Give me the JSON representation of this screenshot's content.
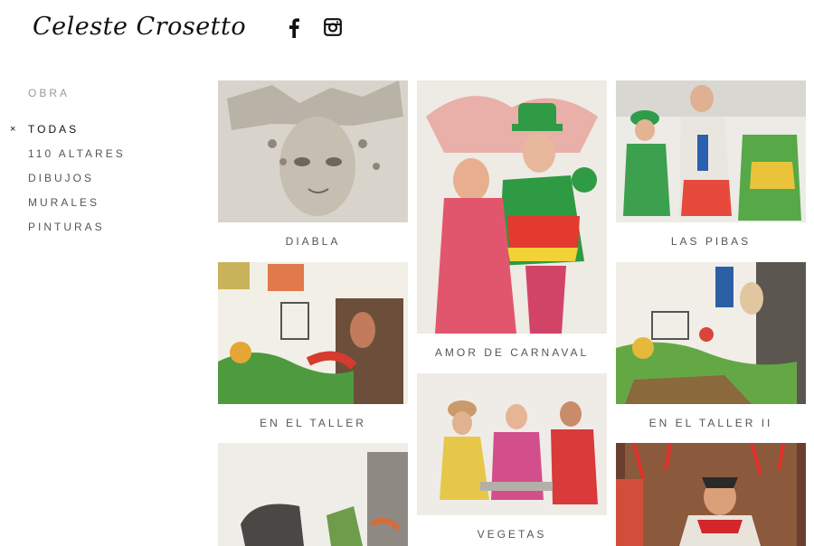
{
  "header": {
    "logo_text": "Celeste Crosetto",
    "social": [
      {
        "icon": "facebook-icon",
        "label": "f"
      },
      {
        "icon": "instagram-icon"
      }
    ]
  },
  "sidebar": {
    "heading": "OBRA",
    "active_marker": "×",
    "items": [
      {
        "label": "TODAS",
        "active": true
      },
      {
        "label": "110 ALTARES",
        "active": false
      },
      {
        "label": "DIBUJOS",
        "active": false
      },
      {
        "label": "MURALES",
        "active": false
      },
      {
        "label": "PINTURAS",
        "active": false
      }
    ]
  },
  "gallery": {
    "items": [
      {
        "title": "DIABLA"
      },
      {
        "title": "AMOR DE CARNAVAL"
      },
      {
        "title": "LAS PIBAS"
      },
      {
        "title": "EN EL TALLER"
      },
      {
        "title": "EN EL TALLER II"
      },
      {
        "title": "VEGETAS"
      }
    ]
  }
}
